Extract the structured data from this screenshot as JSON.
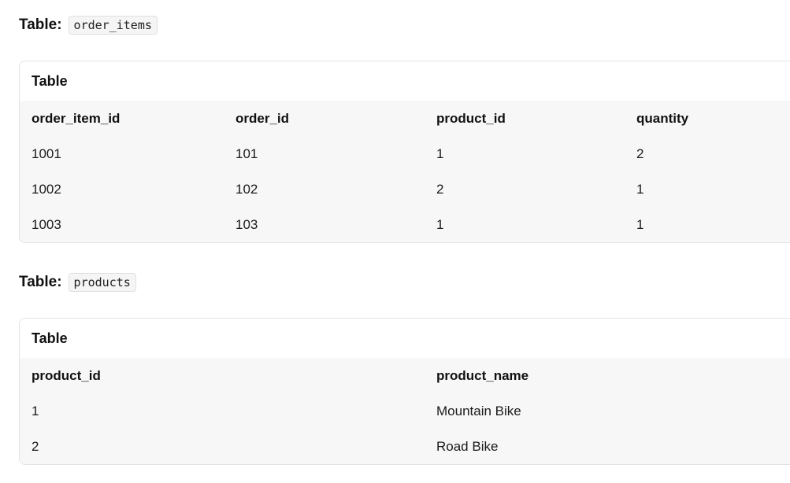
{
  "tables": [
    {
      "heading_prefix": "Table:",
      "name": "order_items",
      "card_title": "Table",
      "columns": [
        "order_item_id",
        "order_id",
        "product_id",
        "quantity"
      ],
      "rows": [
        [
          "1001",
          "101",
          "1",
          "2"
        ],
        [
          "1002",
          "102",
          "2",
          "1"
        ],
        [
          "1003",
          "103",
          "1",
          "1"
        ]
      ]
    },
    {
      "heading_prefix": "Table:",
      "name": "products",
      "card_title": "Table",
      "columns": [
        "product_id",
        "product_name"
      ],
      "rows": [
        [
          "1",
          "Mountain Bike"
        ],
        [
          "2",
          "Road Bike"
        ]
      ]
    }
  ]
}
